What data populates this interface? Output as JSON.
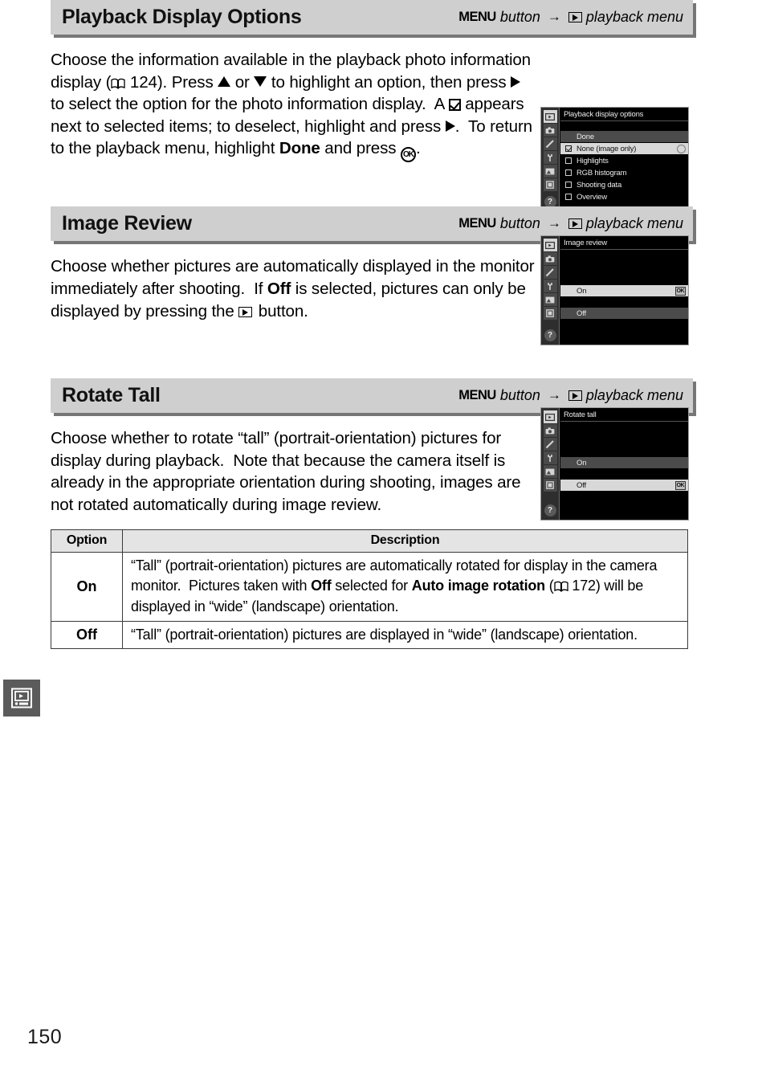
{
  "page": {
    "number": "150",
    "side_tab_icon": "playback-monitor-icon"
  },
  "menu_path": {
    "menu_word": "MENU",
    "button_word": "button",
    "arrow": "→",
    "playback_icon": "playback-icon",
    "menu_label": "playback menu"
  },
  "sections": [
    {
      "id": "playback-display-options",
      "title": "Playback Display Options",
      "body_html": "Choose the information available in the playback photo information display (&#9758; 124). Press &#9650; or &#9660; to highlight an option, then press &#9654; to select the option for the photo information display.  A &#9745; appears next to selected items; to deselect, highlight and press &#9654;.  To return to the playback menu, highlight <b>Done</b> and press OK.",
      "page_ref": "124",
      "bold_words": [
        "Done"
      ],
      "screen": {
        "title": "Playback display options",
        "rows": [
          {
            "label": "Done",
            "style": "grey",
            "checkbox": null,
            "badge": null
          },
          {
            "label": "None (image only)",
            "style": "hl",
            "checkbox": "checked",
            "badge": "circle"
          },
          {
            "label": "Highlights",
            "style": "dark",
            "checkbox": "unchecked",
            "badge": null
          },
          {
            "label": "RGB histogram",
            "style": "dark",
            "checkbox": "unchecked",
            "badge": null
          },
          {
            "label": "Shooting data",
            "style": "dark",
            "checkbox": "unchecked",
            "badge": null
          },
          {
            "label": "Overview",
            "style": "dark",
            "checkbox": "unchecked",
            "badge": null
          }
        ]
      }
    },
    {
      "id": "image-review",
      "title": "Image Review",
      "page_ref": null,
      "screen": {
        "title": "Image review",
        "rows": [
          {
            "label": "On",
            "style": "hl",
            "checkbox": null,
            "badge": "OK"
          },
          {
            "label": "Off",
            "style": "grey",
            "checkbox": null,
            "badge": null
          }
        ]
      }
    },
    {
      "id": "rotate-tall",
      "title": "Rotate Tall",
      "page_ref": null,
      "screen": {
        "title": "Rotate tall",
        "rows": [
          {
            "label": "On",
            "style": "grey",
            "checkbox": null,
            "badge": null
          },
          {
            "label": "Off",
            "style": "hl",
            "checkbox": null,
            "badge": "OK"
          }
        ]
      }
    }
  ],
  "table": {
    "headers": {
      "option": "Option",
      "description": "Description"
    },
    "rows": [
      {
        "option": "On",
        "page_ref": "172"
      },
      {
        "option": "Off",
        "page_ref": null
      }
    ]
  },
  "colors": {
    "heading_bar": "#cfcfcf",
    "heading_shadow": "#767676",
    "table_header": "#e4e4e4",
    "side_tab": "#5b5b5b",
    "screen_highlight": "#d8d8d8",
    "screen_grey_row": "#4b4b4b"
  }
}
